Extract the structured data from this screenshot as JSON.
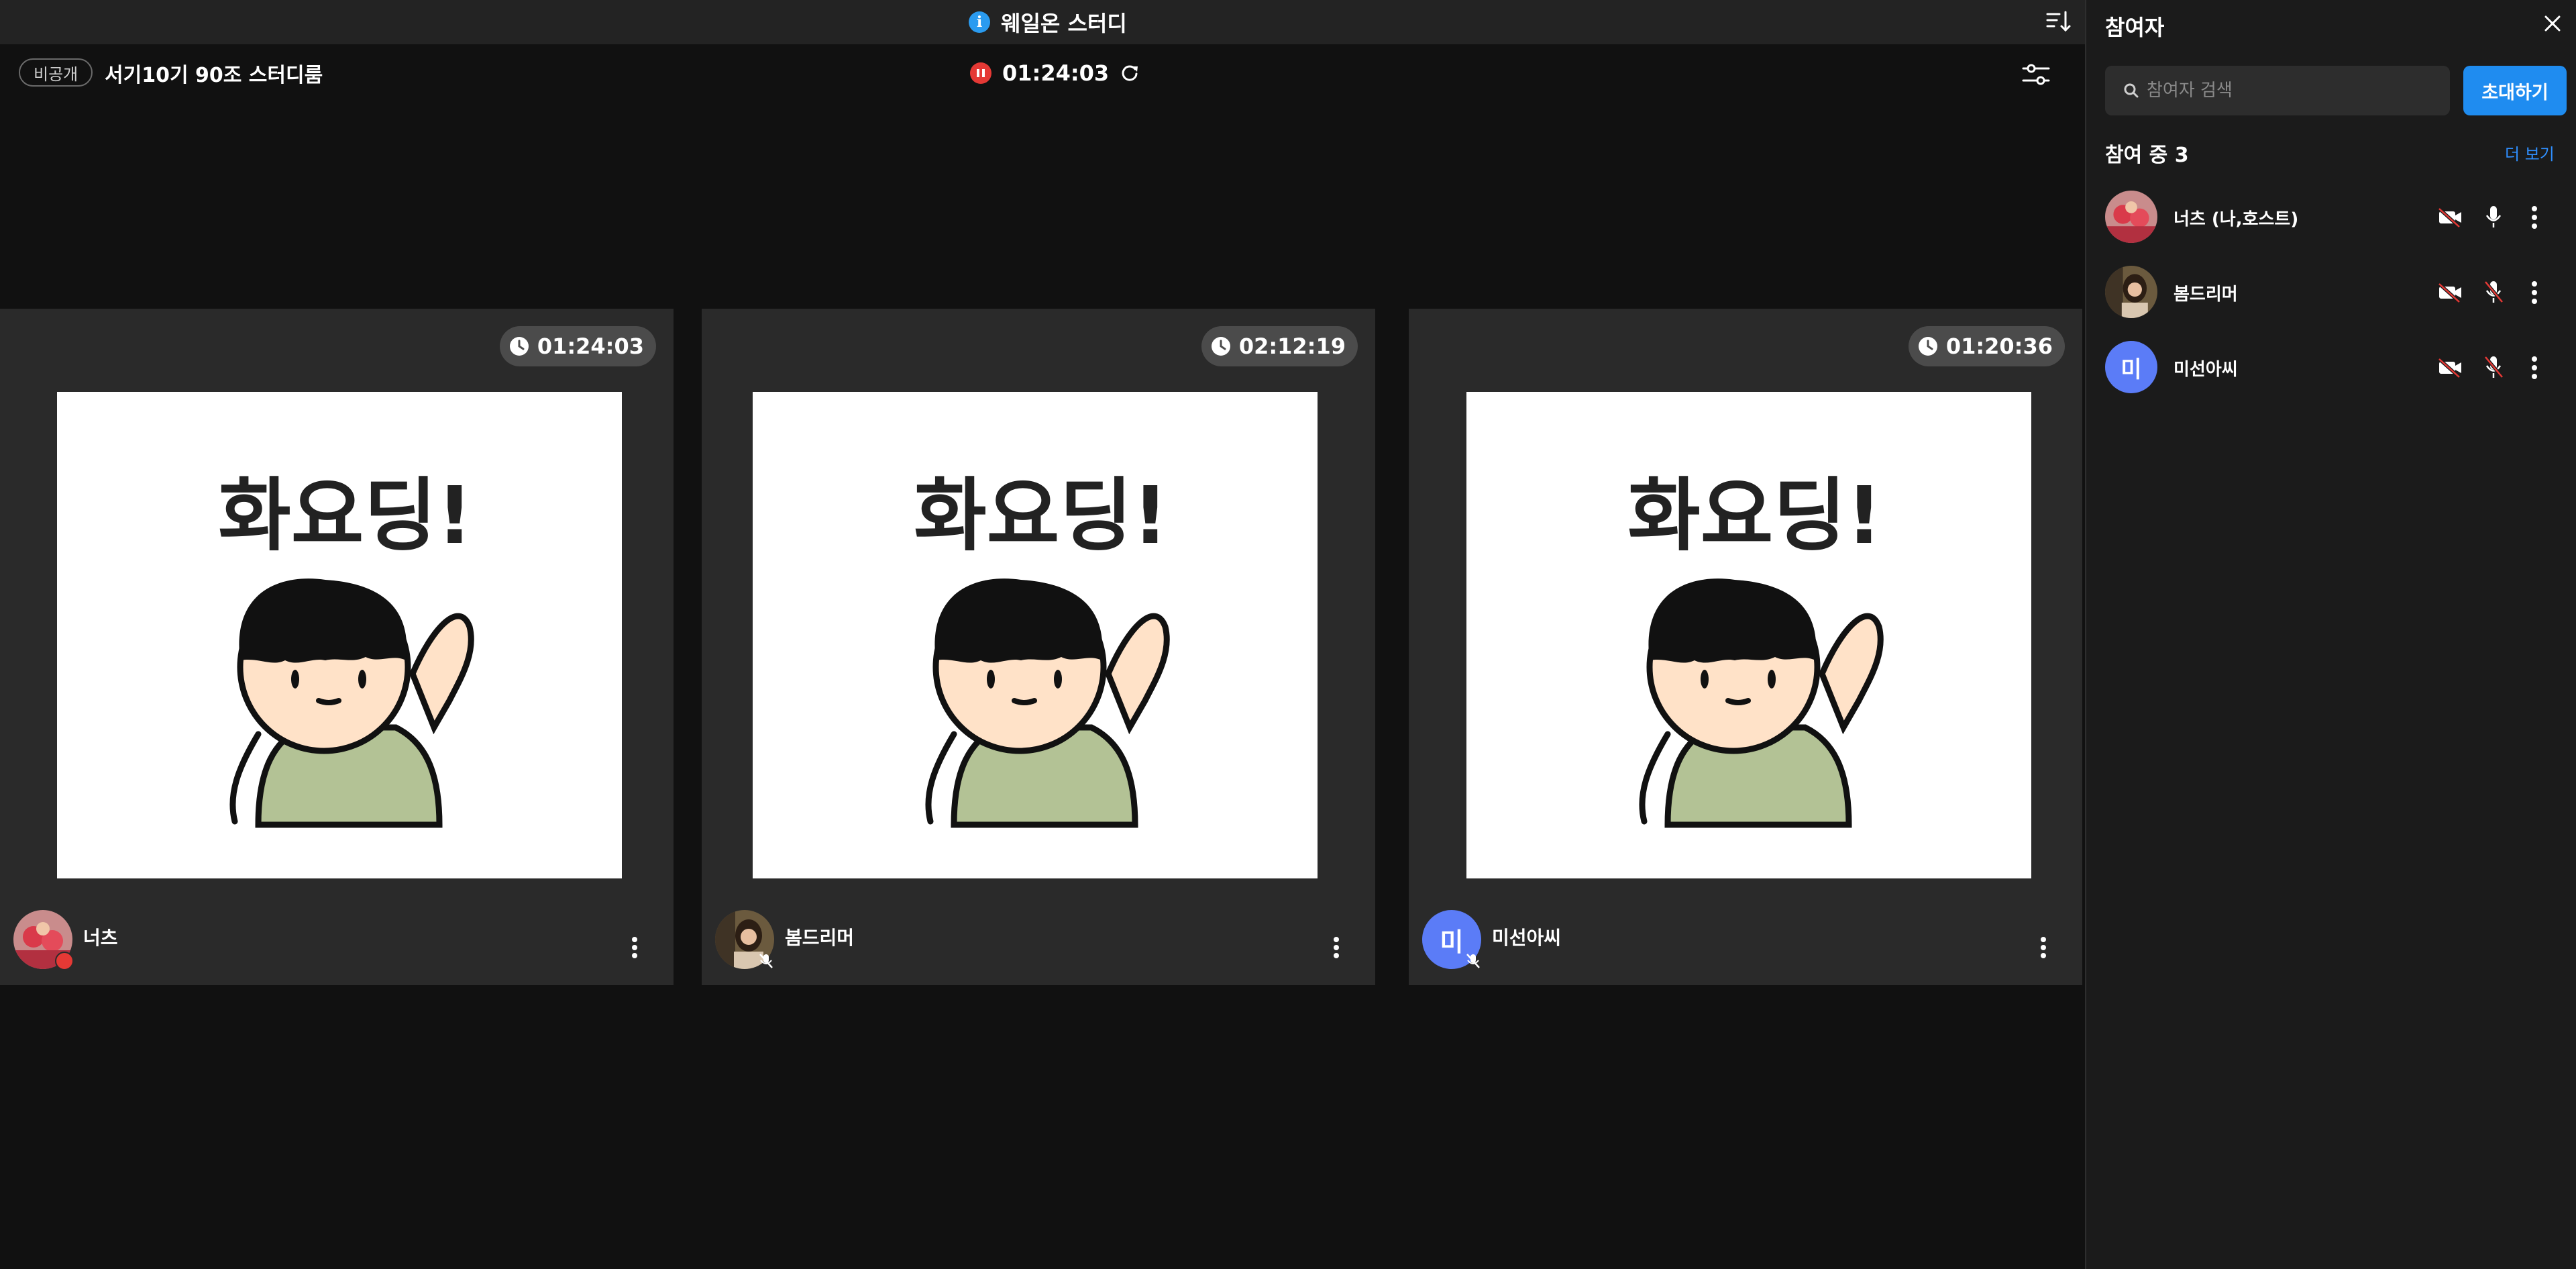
{
  "app": {
    "title": "웨일온 스터디",
    "icons": {
      "info": "info-icon",
      "sort": "sort-icon"
    }
  },
  "room": {
    "visibility_badge": "비공개",
    "name": "서기10기 90조 스터디룸",
    "timer": "01:24:03",
    "timer_state": "paused",
    "icons": {
      "pause": "pause-icon",
      "refresh": "refresh-icon",
      "settings": "settings-icon"
    }
  },
  "tiles": [
    {
      "name": "너츠",
      "time": "01:24:03",
      "avatar": "photo",
      "status": "speaking",
      "sticker_text": "화요딩!"
    },
    {
      "name": "봄드리머",
      "time": "02:12:19",
      "avatar": "photo",
      "status": "muted",
      "sticker_text": "화요딩!"
    },
    {
      "name": "미선아씨",
      "time": "01:20:36",
      "avatar": "initial",
      "initial": "미",
      "status": "muted",
      "sticker_text": "화요딩!"
    }
  ],
  "panel": {
    "title": "참여자",
    "search_placeholder": "참여자 검색",
    "invite_label": "초대하기",
    "count_label": "참여 중 3",
    "more_label": "더 보기",
    "participants": [
      {
        "name": "너츠 (나,호스트)",
        "avatar": "photo",
        "camera": "off",
        "mic": "on"
      },
      {
        "name": "봄드리머",
        "avatar": "photo",
        "camera": "off",
        "mic": "muted"
      },
      {
        "name": "미선아씨",
        "avatar": "initial",
        "initial": "미",
        "camera": "off",
        "mic": "muted"
      }
    ]
  },
  "colors": {
    "background": "#111111",
    "topbar": "#232323",
    "tile": "#2a2a2a",
    "panel": "#1b1b1b",
    "accent_blue": "#1f8cf0",
    "recording_red": "#e53935",
    "initial_avatar": "#5b7cf7",
    "shirt_green": "#b3c295",
    "skin": "#ffe2c8"
  }
}
